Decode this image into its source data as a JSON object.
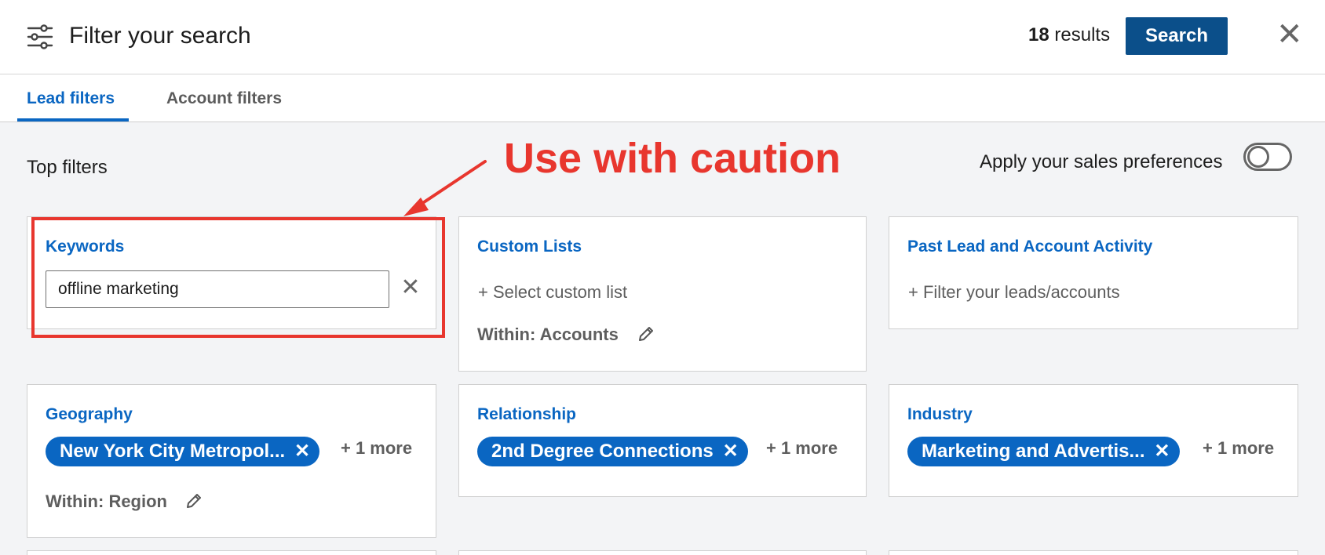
{
  "header": {
    "title": "Filter your search",
    "results_count": "18",
    "results_label": "results",
    "search_label": "Search",
    "close_glyph": "✕"
  },
  "tabs": [
    {
      "label": "Lead filters",
      "active": true
    },
    {
      "label": "Account filters",
      "active": false
    }
  ],
  "top_filters_label": "Top filters",
  "annotation": "Use with caution",
  "preferences": {
    "label": "Apply your sales preferences",
    "enabled": false
  },
  "cards": {
    "keywords": {
      "title": "Keywords",
      "value": "offline marketing",
      "clear_glyph": "✕"
    },
    "custom_lists": {
      "title": "Custom Lists",
      "action": "+ Select custom list",
      "within": "Within: Accounts"
    },
    "past_activity": {
      "title": "Past Lead and Account Activity",
      "action": "+ Filter your leads/accounts"
    },
    "geography": {
      "title": "Geography",
      "pill": "New York City Metropol...",
      "more": "+ 1 more",
      "within": "Within: Region"
    },
    "relationship": {
      "title": "Relationship",
      "pill": "2nd Degree Connections",
      "more": "+ 1 more"
    },
    "industry": {
      "title": "Industry",
      "pill": "Marketing and Advertis...",
      "more": "+ 1 more"
    }
  },
  "pill_remove_glyph": "✕",
  "colors": {
    "brand_blue": "#0a66c2",
    "button_blue": "#0b4f8a",
    "annotation_red": "#e8362e"
  }
}
